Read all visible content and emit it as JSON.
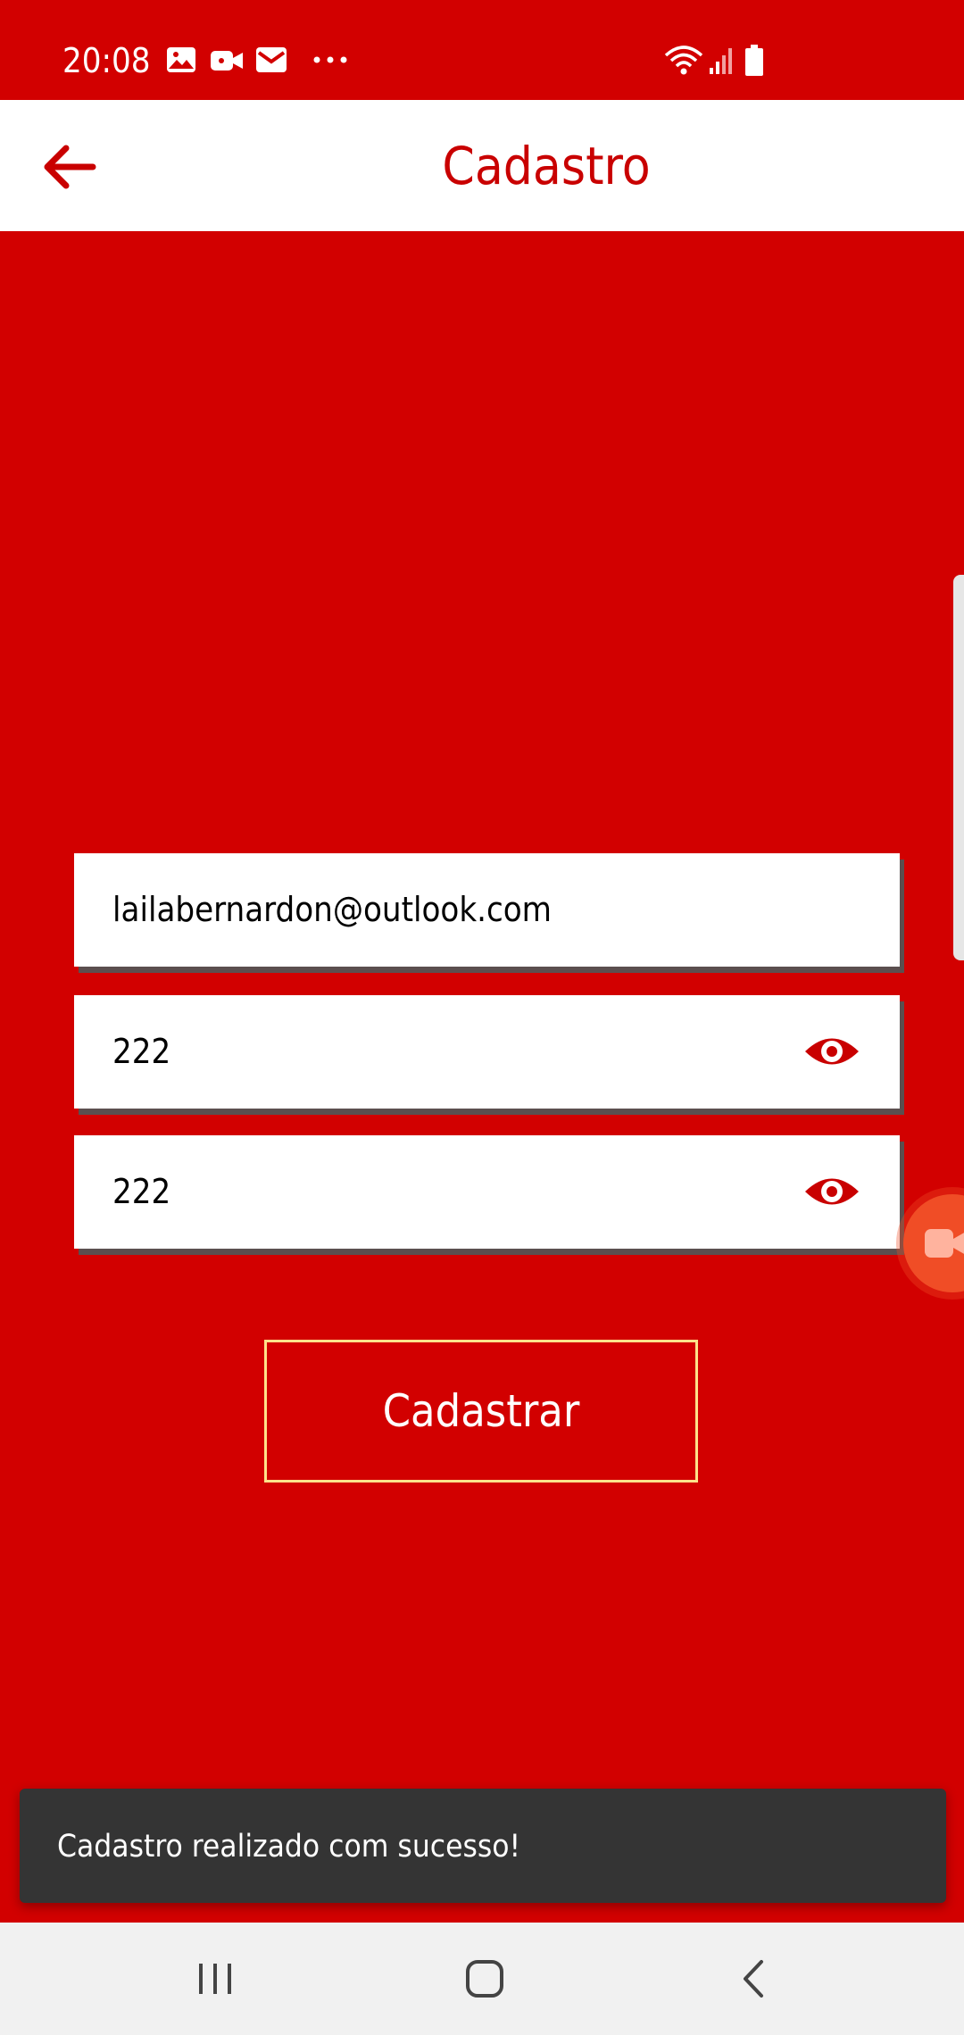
{
  "status_bar": {
    "time": "20:08",
    "left_icons": [
      "image-icon",
      "video-camera-icon",
      "mail-icon",
      "more-dots-icon"
    ],
    "right_icons": [
      "wifi-icon",
      "signal-icon",
      "battery-icon"
    ]
  },
  "header": {
    "back_icon": "arrow-left-icon",
    "title": "Cadastro"
  },
  "form": {
    "email": "lailabernardon@outlook.com",
    "password": "222",
    "confirm_password": "222",
    "visibility_icon": "eye-icon",
    "submit_label": "Cadastrar"
  },
  "toast": {
    "message": "Cadastro realizado com sucesso!"
  },
  "navigation_bar": {
    "buttons": [
      "recent-apps-icon",
      "home-icon",
      "back-icon"
    ]
  },
  "colors": {
    "primary": "#d20000",
    "header_background": "#ffffff",
    "title": "#c90000",
    "toast_background": "#343434",
    "button_border": "#ffe28a",
    "field_shadow": "#5b4f4f"
  }
}
